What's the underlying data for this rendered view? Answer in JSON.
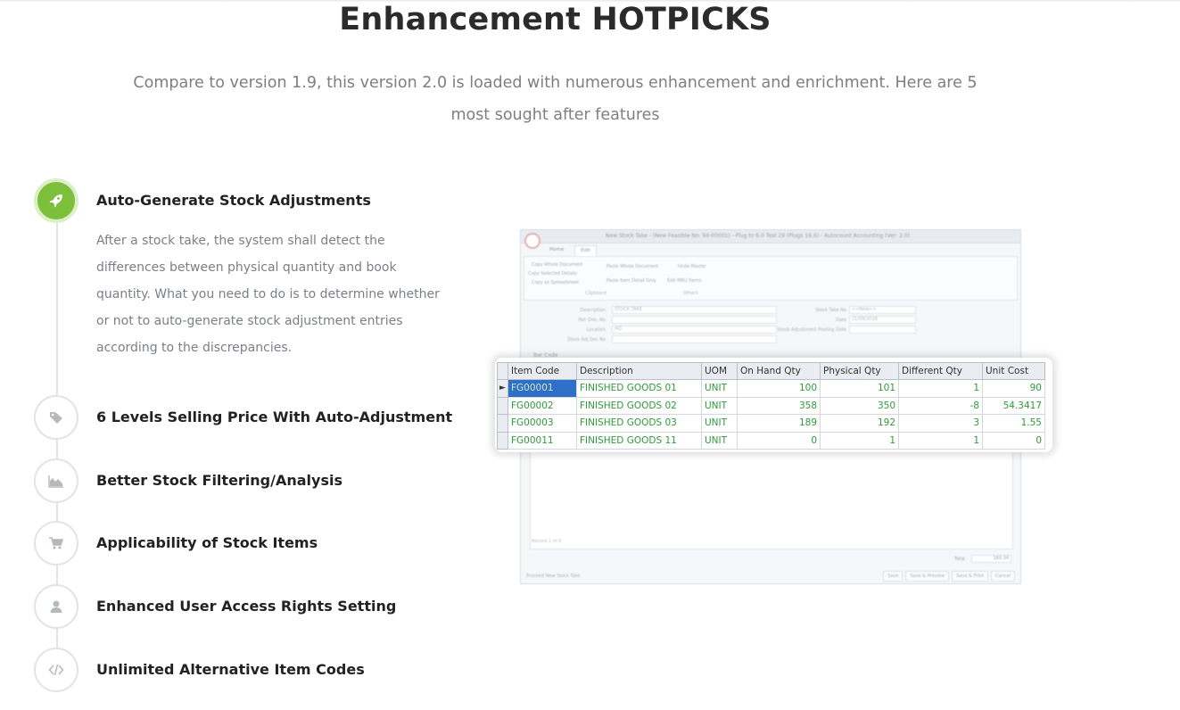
{
  "header": {
    "title": "Enhancement HOTPICKS",
    "subtitle": "Compare to version 1.9, this version 2.0 is loaded with numerous enhancement and enrichment. Here are 5 most sought after features"
  },
  "features": [
    {
      "title": "Auto-Generate Stock Adjustments",
      "icon": "rocket-icon",
      "active": true,
      "description": "After a stock take, the system shall detect the differences between physical quantity and book quantity. What you need to do is to determine whether or not to auto-generate stock adjustment entries according to the discrepancies."
    },
    {
      "title": "6 Levels Selling Price With Auto-Adjustment",
      "icon": "tags-icon",
      "active": false
    },
    {
      "title": "Better Stock Filtering/Analysis",
      "icon": "area-chart-icon",
      "active": false
    },
    {
      "title": "Applicability of Stock Items",
      "icon": "cart-icon",
      "active": false
    },
    {
      "title": "Enhanced User Access Rights Setting",
      "icon": "user-icon",
      "active": false
    },
    {
      "title": "Unlimited Alternative Item Codes",
      "icon": "code-icon",
      "active": false
    }
  ],
  "colors": {
    "accent_green": "#7bbf3a",
    "text_dark": "#222222",
    "text_muted": "#7b7f86",
    "grid_value_green": "#2f9a3a",
    "selected_cell_blue": "#2f6fc7"
  },
  "screenshot": {
    "window_title": "New Stock Take - (New Feasible No. 94-00001) - Plug to 6.0 Test 29 (Plugs 16.6) - Autocount Accounting (Ver: 2.0)",
    "tabs": [
      "Home",
      "Edit"
    ],
    "ribbon": {
      "items": [
        "Copy Whole Document",
        "Copy Selected Details",
        "Copy as Spreadsheet",
        "Paste Whole Document",
        "Paste Item Detail Only",
        "Undo Master",
        "Edit MRU Items"
      ],
      "groups": [
        "Clipboard",
        "Others"
      ]
    },
    "form": {
      "labels": [
        "Description",
        "Ref. Doc. No",
        "Location",
        "Stock Adj Doc No",
        "Stock Take No",
        "Date",
        "Stock Adjustment Posting Date"
      ],
      "values": [
        "STOCK TAKE",
        "",
        "HQ",
        "",
        "<<New>>",
        "21/09/2018",
        ""
      ]
    },
    "barcode_label": "Bar Code",
    "record_nav": "Record 1 of 4",
    "total_label": "Total",
    "total_value": "160.34",
    "checkbox_label": "Proceed New Stock Take",
    "buttons": [
      "Save",
      "Save & Preview",
      "Save & Print",
      "Cancel"
    ]
  },
  "grid": {
    "columns": [
      "Item Code",
      "Description",
      "UOM",
      "On Hand Qty",
      "Physical Qty",
      "Different Qty",
      "Unit Cost"
    ],
    "rows": [
      [
        "FG00001",
        "FINISHED GOODS 01",
        "UNIT",
        "100",
        "101",
        "1",
        "90"
      ],
      [
        "FG00002",
        "FINISHED GOODS 02",
        "UNIT",
        "358",
        "350",
        "-8",
        "54.3417"
      ],
      [
        "FG00003",
        "FINISHED GOODS 03",
        "UNIT",
        "189",
        "192",
        "3",
        "1.55"
      ],
      [
        "FG00011",
        "FINISHED GOODS 11",
        "UNIT",
        "0",
        "1",
        "1",
        "0"
      ]
    ]
  }
}
